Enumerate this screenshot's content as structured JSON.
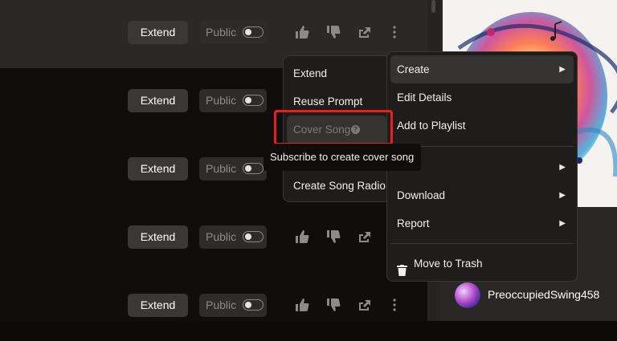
{
  "rows": [
    {
      "extend_label": "Extend",
      "public_label": "Public"
    },
    {
      "extend_label": "Extend",
      "public_label": "Public"
    },
    {
      "extend_label": "Extend",
      "public_label": "Public"
    },
    {
      "extend_label": "Extend",
      "public_label": "Public"
    },
    {
      "extend_label": "Extend",
      "public_label": "Public"
    }
  ],
  "submenu": {
    "items": [
      "Extend",
      "Reuse Prompt",
      "Cover Song",
      "Create Song Radio"
    ],
    "disabled_item": "Cover Song",
    "tooltip": "Subscribe to create cover song"
  },
  "context_menu": {
    "create": "Create",
    "edit_details": "Edit Details",
    "add_to_playlist": "Add to Playlist",
    "share_partial": "e",
    "download": "Download",
    "report": "Report",
    "move_to_trash": "Move to Trash"
  },
  "user": {
    "name": "PreoccupiedSwing458"
  },
  "colors": {
    "highlight_box": "#f01c1c",
    "menu_bg": "#1f1d1c",
    "row_highlight": "#2b2928"
  }
}
